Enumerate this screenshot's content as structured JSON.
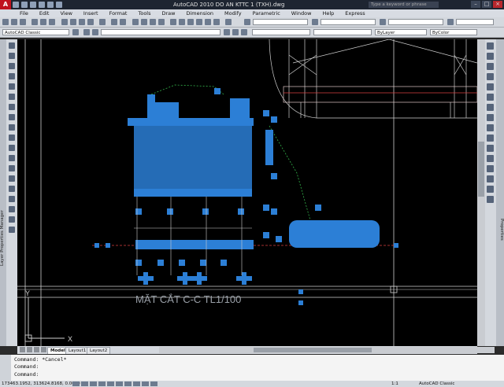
{
  "window": {
    "title": "AutoCAD 2010    DO AN KTTC 1 (TXH).dwg",
    "search_placeholder": "Type a keyword or phrase",
    "minimize": "–",
    "maximize": "□",
    "close": "×",
    "app_logo": "A"
  },
  "menu": {
    "items": [
      "File",
      "Edit",
      "View",
      "Insert",
      "Format",
      "Tools",
      "Draw",
      "Dimension",
      "Modify",
      "Parametric",
      "Window",
      "Help",
      "Express"
    ]
  },
  "toolbar": {
    "workspace": "AutoCAD Classic",
    "layer_value": "ByLayer",
    "color_value": "ByColor"
  },
  "palettes": {
    "left_label": "Layer Properties Manager",
    "right_label": "Properties"
  },
  "drawing": {
    "section_title": "MẶT CẮT C-C TL1/100",
    "ucs_y": "Y",
    "ucs_x": "X"
  },
  "tabs": {
    "items": [
      "Model",
      "Layout1",
      "Layout2"
    ]
  },
  "command": {
    "lines": [
      "Command: *Cancel*",
      "Command:",
      "Command:"
    ]
  },
  "status": {
    "coords": "173463.1952, 313624.8168, 0.0000",
    "scale": "1:1",
    "workspace": "AutoCAD Classic"
  },
  "colors": {
    "grip_blue": "#2c7fd6",
    "canvas": "#000000",
    "drawing_lines": "#cfcfcf",
    "leader_green": "#33b24a",
    "dim_red": "#d94040"
  }
}
